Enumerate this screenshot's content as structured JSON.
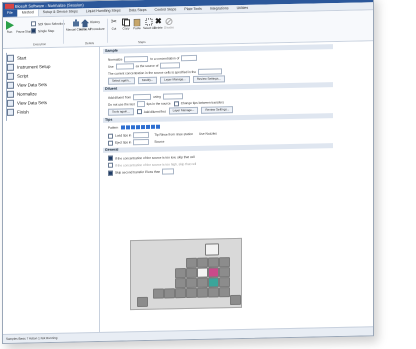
{
  "window": {
    "title": "Biosoft Software - Normalize (Session)"
  },
  "menu": {
    "tabs": [
      "File",
      "Method",
      "Setup & Device Steps",
      "Liquid Handling Steps",
      "Data Steps",
      "Control Steps",
      "Plate Tools",
      "Integrations",
      "Utilities"
    ]
  },
  "ribbon": {
    "run_label": "Run",
    "pause_label": "Pause",
    "stop_label": "Stop",
    "cb1_label": "SDI Steo Selection",
    "cb2_label": "Single Step",
    "execution_label": "Execution",
    "manual_label": "Manual Control",
    "home_label": "Home All",
    "history_label": "History",
    "procedure_label": "Procedure",
    "details_label": "Details",
    "cut_label": "Cut",
    "copy_label": "Copy",
    "paste_label": "Paste",
    "select_all_label": "Select All",
    "delete_label": "Delete",
    "disable_label": "Disable",
    "steps_label": "Steps"
  },
  "steps": [
    {
      "label": "Start"
    },
    {
      "label": "Instrument Setup"
    },
    {
      "label": "Script"
    },
    {
      "label": "View Data Sets"
    },
    {
      "label": "Normalize"
    },
    {
      "label": "View Data Sets"
    },
    {
      "label": "Finish"
    }
  ],
  "sample": {
    "header": "Sample",
    "row1": "Normalize",
    "row1b": "to a concentration of",
    "row2": "Use",
    "row2b": "as the source of",
    "row3": "The current concentration in the source cells is specified in the",
    "btn1": "Select again...",
    "btn2": "Modify...",
    "btn3": "Layer Manage...",
    "btn4": "Review Settings..."
  },
  "diluent": {
    "header": "Diluent",
    "row1": "Add diluent from",
    "row1b": "using",
    "row2": "Do not use the last",
    "row2b": "tips in the source",
    "row2c": "Change tips between transfers",
    "btn1": "Tools again...",
    "btn2": "Add diluent first",
    "btn3": "Layer Manage...",
    "btn4": "Review Settings..."
  },
  "tips": {
    "header": "Tips",
    "row1": "Pattern",
    "row2": "Load tips in",
    "row2b": "Tip Rinse from rinse station",
    "row2c": "Use Nozzles",
    "row3": "Eject tips in",
    "row3b": "Source"
  },
  "general": {
    "header": "General",
    "row1": "If the concentration of the source is too low, skip that cell",
    "row2": "If the concentration of the source is too high, skip that cell",
    "row3": "Skip second transfer if less than"
  },
  "status": {
    "text": "Samples  Basic 7  Action 1     Not Running"
  }
}
